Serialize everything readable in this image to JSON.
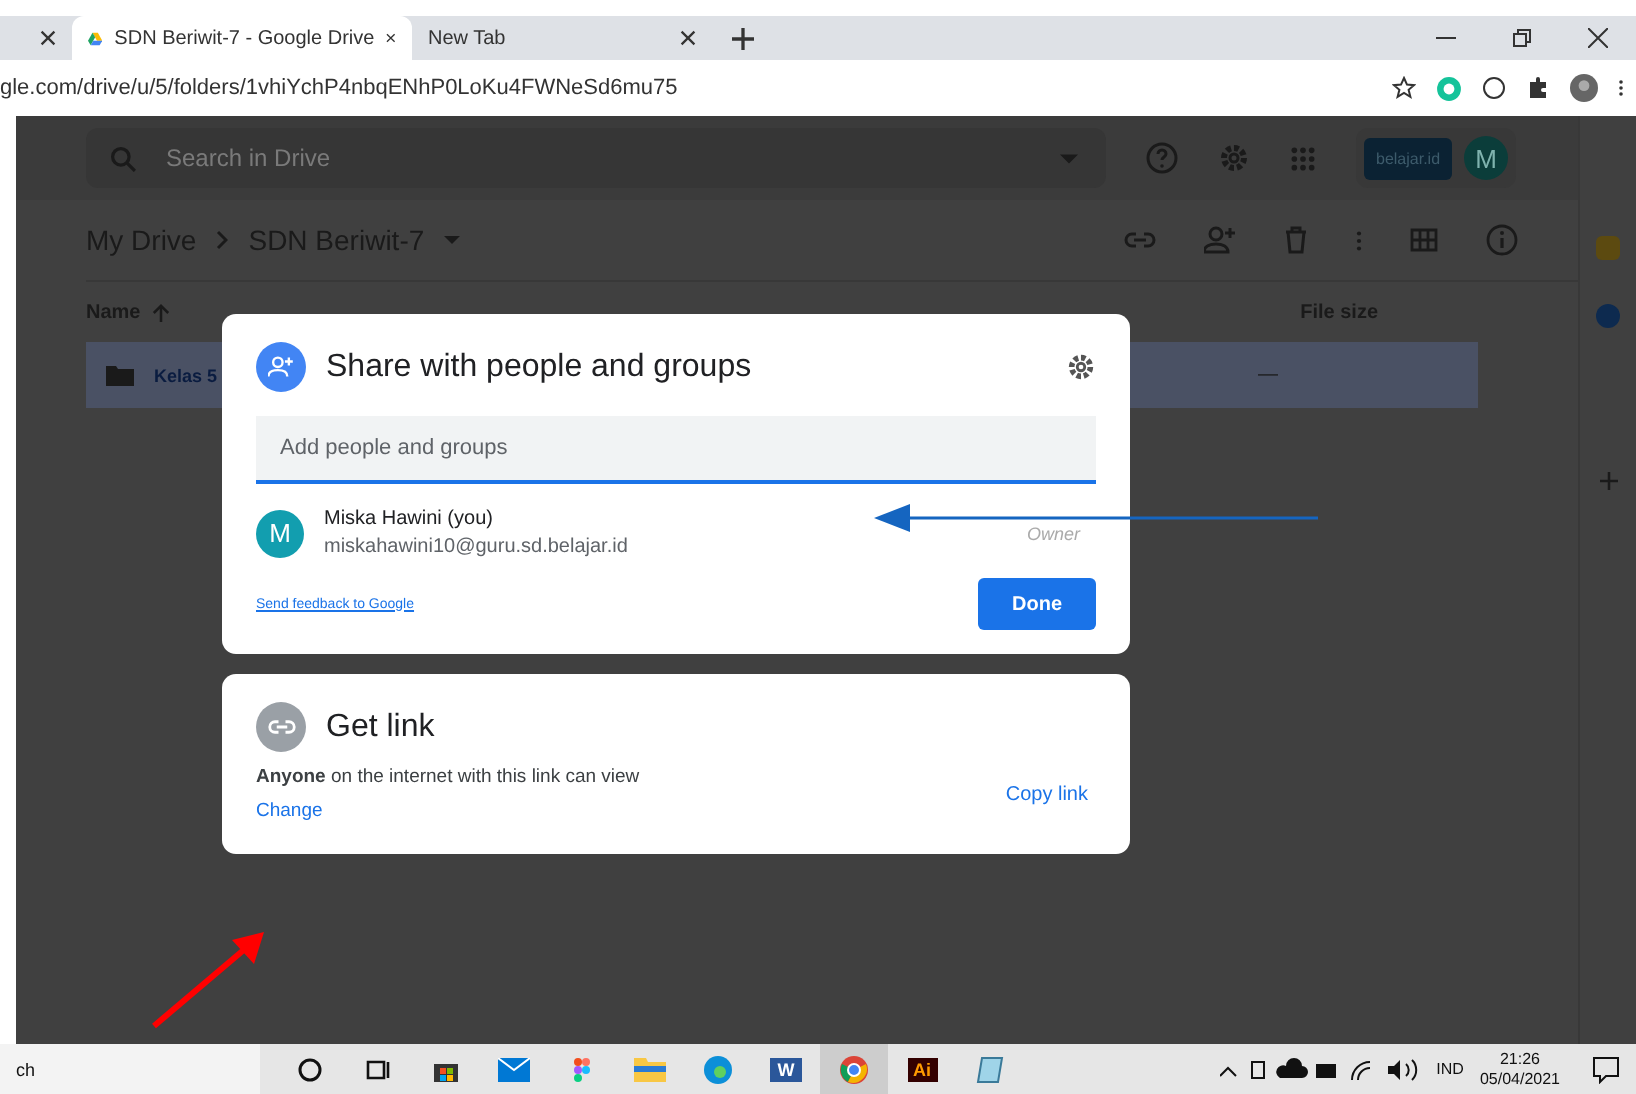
{
  "browser": {
    "tabs": [
      {
        "selected": false
      },
      {
        "title": "SDN Beriwit-7 - Google Drive",
        "selected": true
      },
      {
        "title": "New Tab",
        "selected": false
      }
    ],
    "url": "gle.com/drive/u/5/folders/1vhiYchP4nbqENhP0LoKu4FWNeSd6mu75"
  },
  "drive": {
    "search": {
      "placeholder": "Search in Drive"
    },
    "account_badge": "belajar.id",
    "avatar": "M",
    "breadcrumbs": [
      "My Drive",
      "SDN Beriwit-7"
    ],
    "columns": [
      "Name",
      "File size"
    ],
    "rows": [
      {
        "name": "Kelas 5",
        "size": "—",
        "selected": true
      }
    ]
  },
  "share_dialog": {
    "title": "Share with people and groups",
    "input": {
      "placeholder": "Add people and groups"
    },
    "people": [
      {
        "avatar": "M",
        "name": "Miska Hawini (you)",
        "email": "miskahawini10@guru.sd.belajar.id",
        "role": "Owner"
      }
    ],
    "feedback_link": "Send feedback to Google",
    "done": "Done"
  },
  "link_dialog": {
    "title": "Get link",
    "description": "**Anyone** on the internet with this link can view",
    "change": "Change",
    "copy": "Copy link"
  },
  "taskbar": {
    "search": "ch",
    "apps": [
      {
        "kind": "cortana",
        "selected": false
      },
      {
        "kind": "taskview",
        "selected": false
      },
      {
        "kind": "store",
        "selected": false
      },
      {
        "kind": "mail",
        "selected": false
      },
      {
        "kind": "figma",
        "selected": false
      },
      {
        "kind": "explorer",
        "selected": false
      },
      {
        "kind": "edge",
        "selected": false
      },
      {
        "kind": "word",
        "label": "W",
        "selected": false
      },
      {
        "kind": "chrome",
        "selected": true
      },
      {
        "kind": "illustrator",
        "label": "Ai",
        "selected": false
      },
      {
        "kind": "notes",
        "selected": false
      }
    ],
    "language": "IND",
    "time": "21:26",
    "date": "05/04/2021"
  }
}
